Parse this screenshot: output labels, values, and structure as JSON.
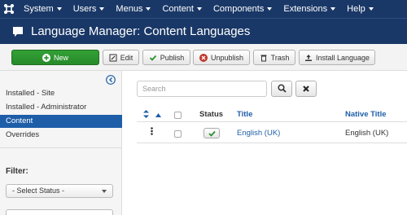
{
  "topnav": {
    "items": [
      {
        "label": "System"
      },
      {
        "label": "Users"
      },
      {
        "label": "Menus"
      },
      {
        "label": "Content"
      },
      {
        "label": "Components"
      },
      {
        "label": "Extensions"
      },
      {
        "label": "Help"
      }
    ]
  },
  "page": {
    "title": "Language Manager: Content Languages"
  },
  "toolbar": {
    "new_label": "New",
    "edit_label": "Edit",
    "publish_label": "Publish",
    "unpublish_label": "Unpublish",
    "trash_label": "Trash",
    "install_label": "Install Language"
  },
  "sidebar": {
    "items": [
      {
        "label": "Installed - Site",
        "active": false
      },
      {
        "label": "Installed - Administrator",
        "active": false
      },
      {
        "label": "Content",
        "active": true
      },
      {
        "label": "Overrides",
        "active": false
      }
    ],
    "filter_label": "Filter:",
    "status_select": "- Select Status -"
  },
  "search": {
    "placeholder": "Search"
  },
  "table": {
    "headers": {
      "status": "Status",
      "title": "Title",
      "native_title": "Native Title"
    },
    "rows": [
      {
        "title": "English (UK)",
        "native_title": "English (UK)",
        "published": true
      }
    ]
  },
  "colors": {
    "nav_bg": "#1a3867",
    "accent": "#1e5ea8",
    "success": "#2a8f2d",
    "danger": "#c0392b"
  }
}
